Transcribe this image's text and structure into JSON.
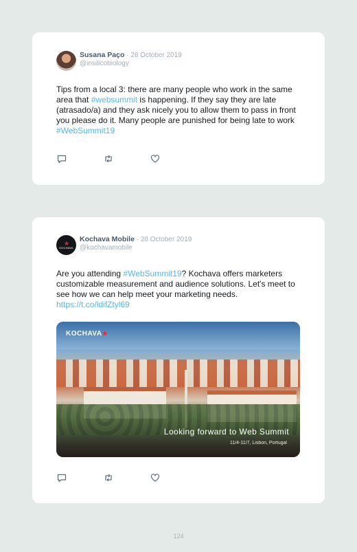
{
  "tweets": [
    {
      "display_name": "Susana Paço",
      "separator": " · ",
      "date": "28 October 2019",
      "handle": "@insilicobiology",
      "text": {
        "p1": "Tips from a local 3: there are many people who work in the same area that ",
        "tag1": "#websummit",
        "p2": " is happening. If they say they are late (atrasado/a) and they ask nicely you to allow them to pass in front you please do it. Many people are punished for being late to work ",
        "tag2": "#WebSummit19"
      }
    },
    {
      "display_name": "Kochava Mobile",
      "separator": " · ",
      "date": "28 October 2019",
      "handle": "@kochavamobile",
      "avatar_text": "KOCHAVA",
      "text": {
        "p1": "Are you attending ",
        "tag1": "#WebSummit19",
        "p2": "? Kochava offers marketers customizable measurement and audience solutions. Let's meet to see how we can help meet your marketing needs. ",
        "link": "https://t.co/ldifZtyl69"
      },
      "media": {
        "logo": "KOCHAVA",
        "logo_star": "★",
        "caption": "Looking forward to Web Summit",
        "caption_sub": "11/4-11/7, Lisbon, Portugal"
      }
    }
  ],
  "icons": [
    "reply-icon",
    "retweet-icon",
    "like-icon"
  ],
  "colors": {
    "background": "#e4eae7",
    "hashtag": "#55b7e9",
    "name": "#4b5966",
    "muted": "#a6aeb5"
  },
  "page_number": "124"
}
